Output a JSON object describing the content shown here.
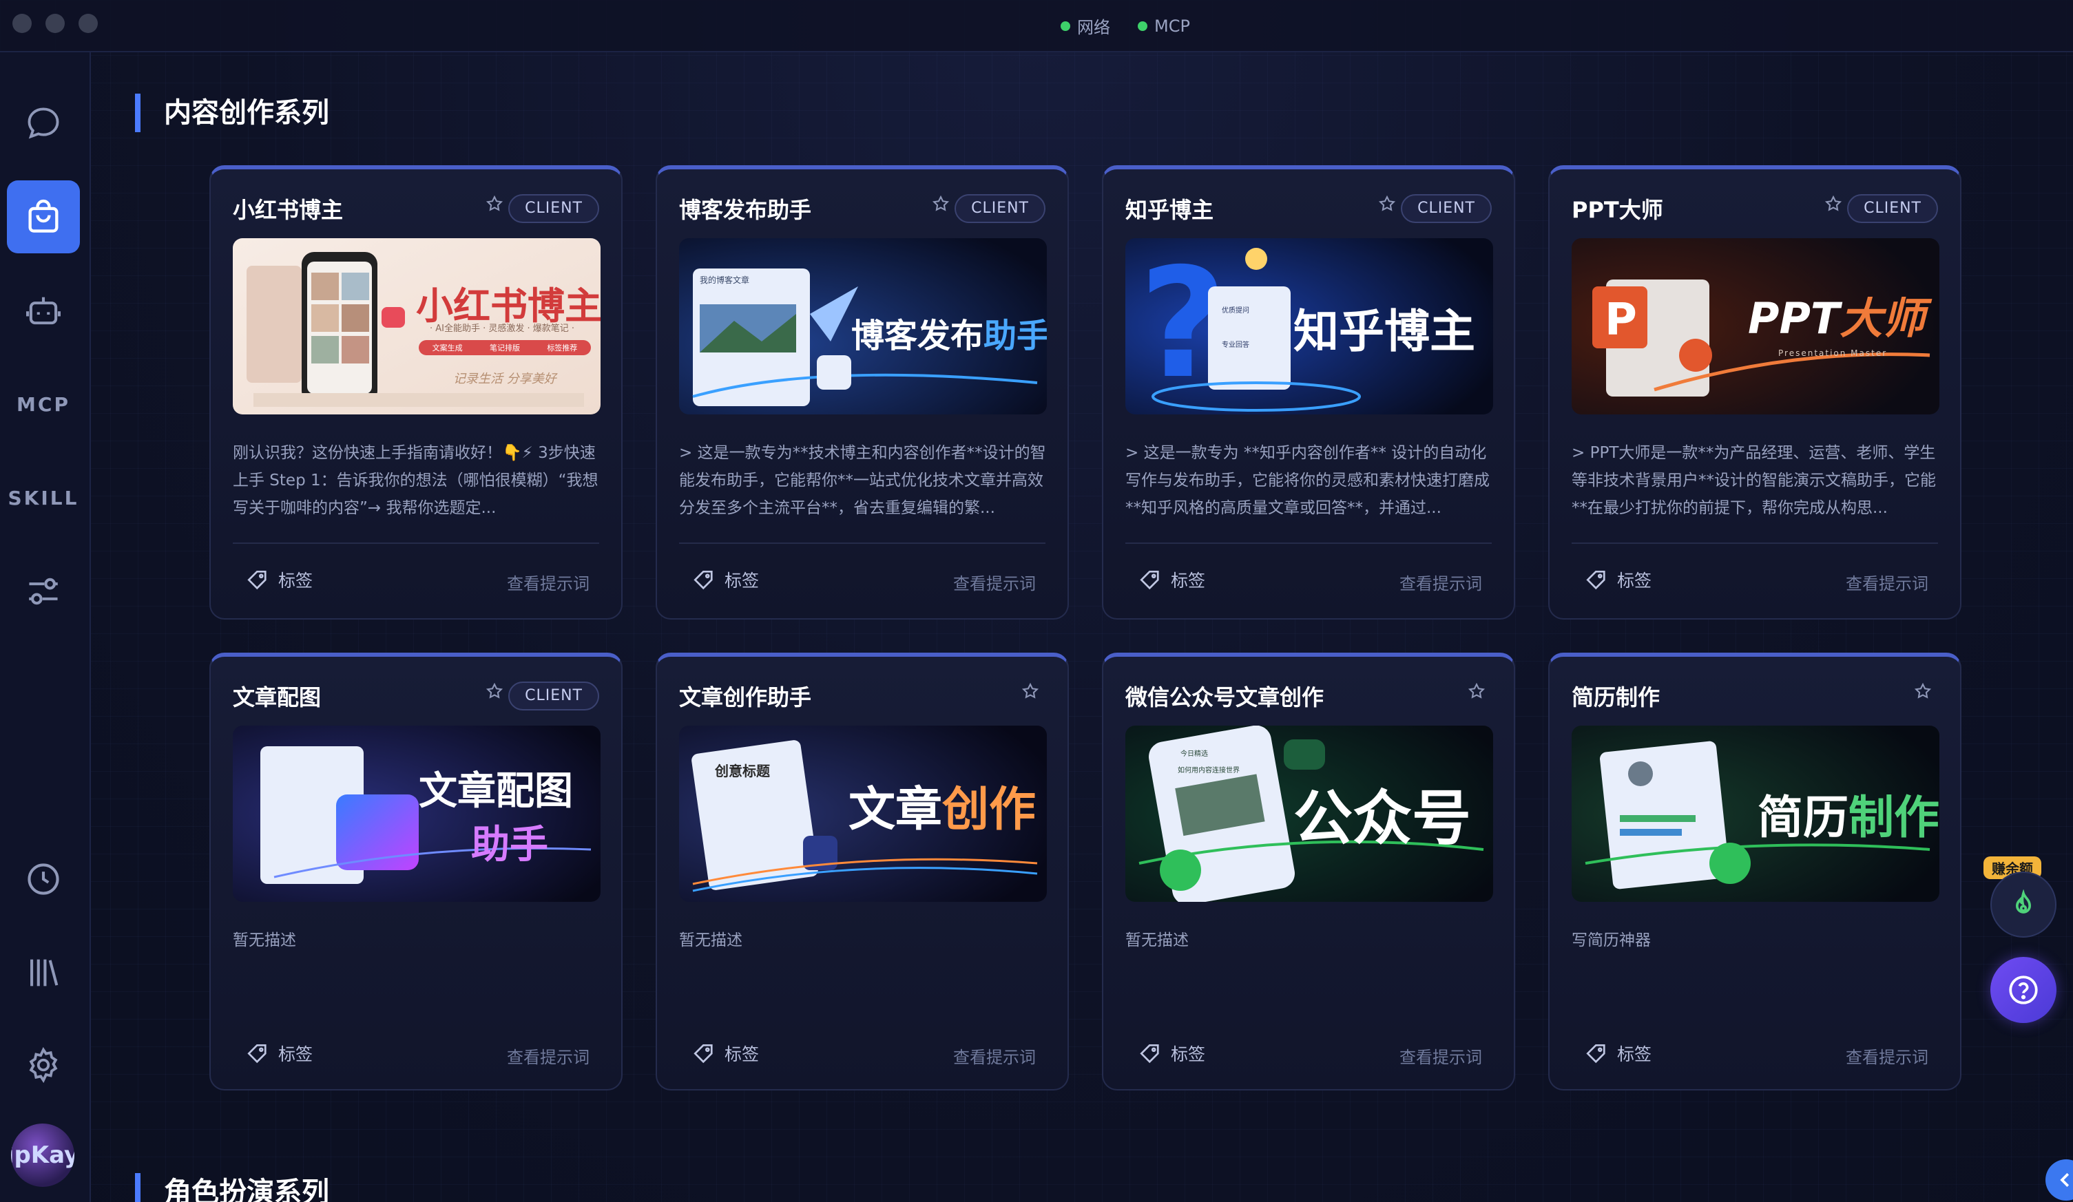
{
  "titlebar": {
    "status": [
      {
        "label": "网络",
        "color": "#3ed06a"
      },
      {
        "label": "MCP",
        "color": "#3ed06a"
      }
    ]
  },
  "sidebar": {
    "items": [
      {
        "icon": "chat-icon"
      },
      {
        "icon": "shopping-bag-icon",
        "active": true
      },
      {
        "icon": "robot-icon"
      },
      {
        "label": "MCP"
      },
      {
        "label": "SKILL"
      },
      {
        "icon": "sliders-icon"
      },
      {
        "icon": "clock-icon"
      },
      {
        "icon": "library-icon"
      },
      {
        "icon": "gear-icon"
      }
    ],
    "avatar_text": "ipKay"
  },
  "sections": [
    {
      "title": "内容创作系列"
    },
    {
      "title": "角色扮演系列"
    }
  ],
  "cards": [
    {
      "title": "小红书博主",
      "badge": "CLIENT",
      "cover_text": "小红书博主",
      "cover_subtext": "· AI全能助手 · 灵感激发 · 爆款笔记 ·",
      "cover_pills": [
        "文案生成",
        "笔记排版",
        "标签推荐"
      ],
      "cover_caption": "记录生活 分享美好",
      "description": "刚认识我？这份快速上手指南请收好！👇⚡ 3步快速上手 Step 1：告诉我你的想法（哪怕很模糊）“我想写关于咖啡的内容”→ 我帮你选题定...",
      "tag_label": "标签",
      "link_label": "查看提示词"
    },
    {
      "title": "博客发布助手",
      "badge": "CLIENT",
      "cover_text_a": "博客发布",
      "cover_text_b": "助手",
      "cover_mini": "我的博客文章",
      "description": "> 这是一款专为**技术博主和内容创作者**设计的智能发布助手，它能帮你**一站式优化技术文章并高效分发至多个主流平台**，省去重复编辑的繁...",
      "tag_label": "标签",
      "link_label": "查看提示词"
    },
    {
      "title": "知乎博主",
      "badge": "CLIENT",
      "cover_text": "知乎博主",
      "cover_mini_q": "优质提问",
      "cover_mini_a": "专业回答",
      "description": "> 这是一款专为 **知乎内容创作者** 设计的自动化写作与发布助手，它能将你的灵感和素材快速打磨成 **知乎风格的高质量文章或回答**，并通过...",
      "tag_label": "标签",
      "link_label": "查看提示词"
    },
    {
      "title": "PPT大师",
      "badge": "CLIENT",
      "cover_text_a": "PPT",
      "cover_text_b": "大师",
      "cover_sub": "Presentation Master",
      "description": "> PPT大师是一款**为产品经理、运营、老师、学生等非技术背景用户**设计的智能演示文稿助手，它能**在最少打扰你的前提下，帮你完成从构思...",
      "tag_label": "标签",
      "link_label": "查看提示词"
    },
    {
      "title": "文章配图",
      "badge": "CLIENT",
      "cover_text_a": "文章配图",
      "cover_text_b": "助手",
      "description": "暂无描述",
      "tag_label": "标签",
      "link_label": "查看提示词"
    },
    {
      "title": "文章创作助手",
      "badge": "",
      "cover_text_a": "文章",
      "cover_text_b": "创作",
      "cover_mini": "创意标题",
      "description": "暂无描述",
      "tag_label": "标签",
      "link_label": "查看提示词"
    },
    {
      "title": "微信公众号文章创作",
      "badge": "",
      "cover_text": "公众号",
      "cover_mini": "今日精选",
      "cover_mini2": "如何用内容连接世界",
      "description": "暂无描述",
      "tag_label": "标签",
      "link_label": "查看提示词"
    },
    {
      "title": "简历制作",
      "badge": "",
      "cover_text_a": "简历",
      "cover_text_b": "制作",
      "description": "写简历神器",
      "tag_label": "标签",
      "link_label": "查看提示词"
    }
  ],
  "floating": {
    "earn_label": "赚余额"
  }
}
